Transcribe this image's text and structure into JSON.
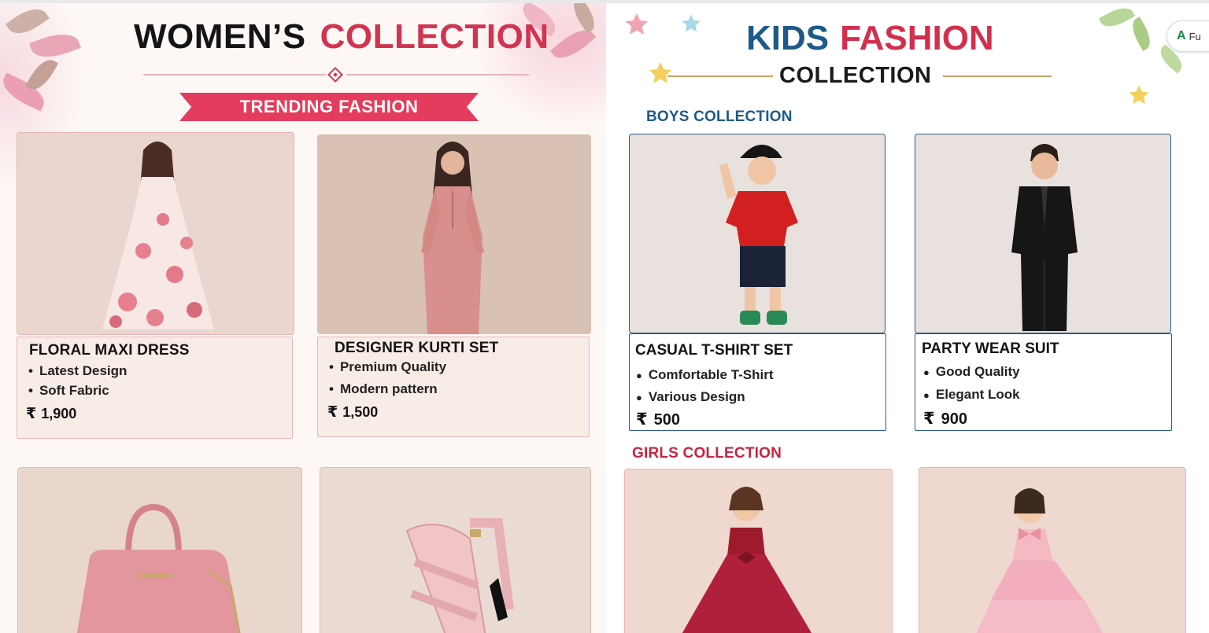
{
  "women": {
    "title_part1": "WOMEN’S",
    "title_part2": "COLLECTION",
    "ribbon": "TRENDING FASHION",
    "products": [
      {
        "name": "FLORAL MAXI DRESS",
        "bullets": [
          "Latest Design",
          "Soft Fabric"
        ],
        "currency": "₹",
        "price": "1,900"
      },
      {
        "name": "DESIGNER KURTI SET",
        "bullets": [
          "Premium Quality",
          "Modern pattern"
        ],
        "currency": "₹",
        "price": "1,500"
      }
    ]
  },
  "kids": {
    "title_part1": "KIDS",
    "title_part2": "FASHION",
    "subtitle": "COLLECTION",
    "boys_label": "BOYS COLLECTION",
    "girls_label": "GIRLS COLLECTION",
    "boys": [
      {
        "name": "CASUAL T-SHIRT SET",
        "bullets": [
          "Comfortable T-Shirt",
          "Various Design"
        ],
        "currency": "₹",
        "price": "500"
      },
      {
        "name": "PARTY WEAR SUIT",
        "bullets": [
          "Good Quality",
          "Elegant Look"
        ],
        "currency": "₹",
        "price": "900"
      }
    ]
  },
  "translate": {
    "label": "Fu"
  },
  "colors": {
    "accent_red": "#d03451",
    "kids_blue": "#1d5a8a",
    "gold": "#c9a169",
    "card_bg": "#f8ece7"
  }
}
